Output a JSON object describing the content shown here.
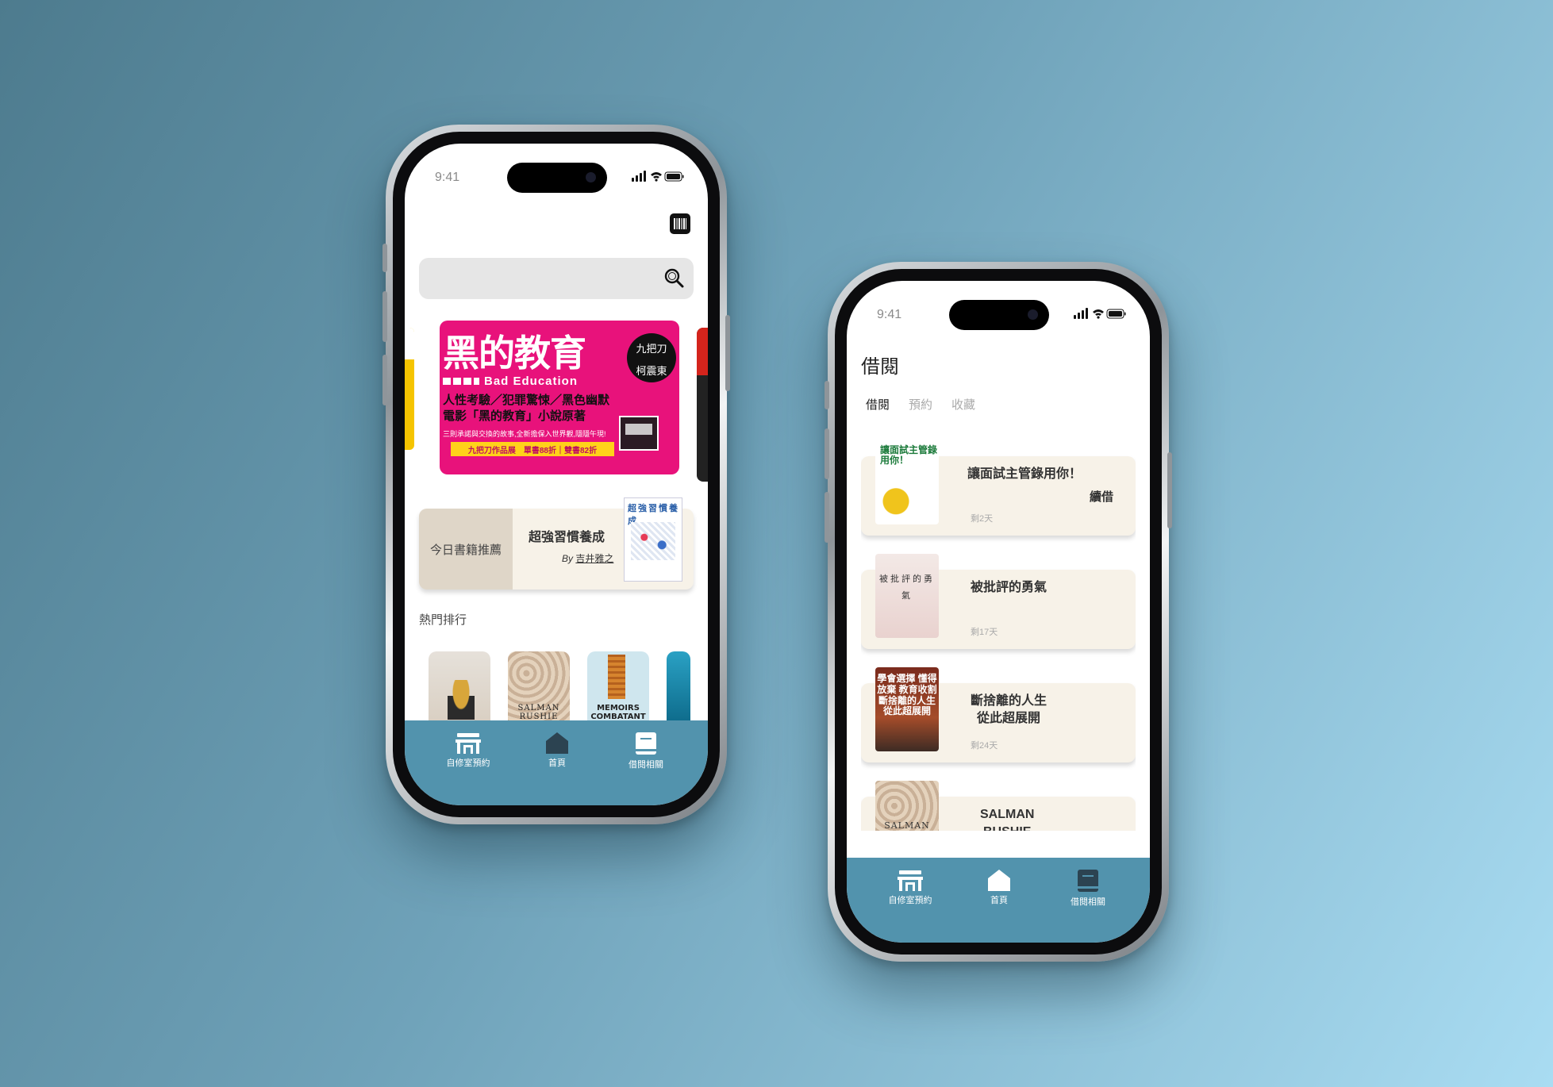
{
  "status": {
    "time": "9:41"
  },
  "home": {
    "banner": {
      "title": "黑的教育",
      "subtitle": "Bad Education",
      "line1": "人性考驗／犯罪驚悚／黑色幽默",
      "line2": "電影「黑的教育」小說原著",
      "tiny": "三則承諾與交換的故事,全新擔保入世界觀,隱隱午現!",
      "price": "九把刀作品展　單書88折｜雙書82折",
      "badge_top": "九把刀",
      "badge_bottom": "柯震東"
    },
    "recommend": {
      "label": "今日書籍推薦",
      "title": "超強習慣養成",
      "by": "By",
      "author": "吉井雅之",
      "cover_title": "超強習慣養成"
    },
    "ranking_title": "熱門排行",
    "ranking": [
      {
        "cover_text": ""
      },
      {
        "cover_text": "SALMAN RUSHIE"
      },
      {
        "cover_text": "MEMOIRS COMBATANT"
      },
      {
        "cover_text": ""
      }
    ]
  },
  "borrow": {
    "title": "借閱",
    "tabs": [
      "借閱",
      "預約",
      "收藏"
    ],
    "items": [
      {
        "title": "讓面試主管錄用你！",
        "days": "剩2天",
        "action": "續借",
        "cover_text": "讓面試主管錄用你！"
      },
      {
        "title": "被批評的勇氣",
        "days": "剩17天",
        "action": "",
        "cover_text": "被批評的勇氣"
      },
      {
        "title": "斷捨離的人生\n從此超展開",
        "days": "剩24天",
        "action": "",
        "cover_text": "學會選擇 懂得放棄 教育收割 斷捨離的人生 從此超展開"
      },
      {
        "title": "SALMAN\nBUSHIE",
        "days": "",
        "action": "",
        "cover_text": "SALMAN BUSHIE"
      }
    ]
  },
  "tabbar": [
    {
      "label": "自修室預約",
      "icon": "desk-icon"
    },
    {
      "label": "首頁",
      "icon": "home-icon"
    },
    {
      "label": "借閱相關",
      "icon": "book-icon"
    }
  ],
  "colors": {
    "tabbar": "#5293ad",
    "card": "#f7f2e8",
    "banner": "#e8127b"
  }
}
